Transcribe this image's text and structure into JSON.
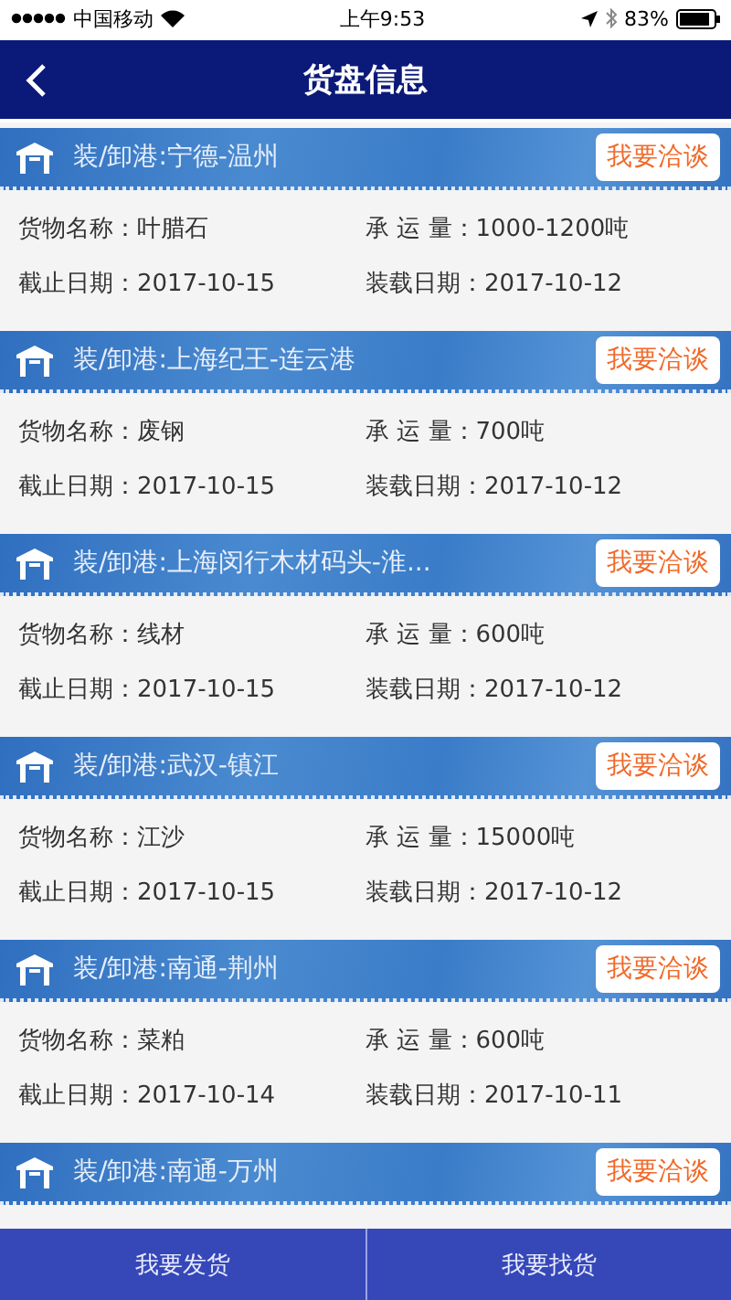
{
  "status_bar": {
    "carrier": "中国移动",
    "time": "上午9:53",
    "battery": "83%"
  },
  "nav": {
    "title": "货盘信息"
  },
  "cargo_list": [
    {
      "route": "装/卸港:宁德-温州",
      "action": "我要洽谈",
      "fields": [
        {
          "label": "货物名称：",
          "value": "叶腊石"
        },
        {
          "label": "承 运 量：",
          "value": "1000-1200吨"
        },
        {
          "label": "截止日期：",
          "value": "2017-10-15"
        },
        {
          "label": "装载日期：",
          "value": "2017-10-12"
        }
      ]
    },
    {
      "route": "装/卸港:上海纪王-连云港",
      "action": "我要洽谈",
      "fields": [
        {
          "label": "货物名称：",
          "value": "废钢"
        },
        {
          "label": "承 运 量：",
          "value": "700吨"
        },
        {
          "label": "截止日期：",
          "value": "2017-10-15"
        },
        {
          "label": "装载日期：",
          "value": "2017-10-12"
        }
      ]
    },
    {
      "route": "装/卸港:上海闵行木材码头-淮...",
      "action": "我要洽谈",
      "fields": [
        {
          "label": "货物名称：",
          "value": "线材"
        },
        {
          "label": "承 运 量：",
          "value": "600吨"
        },
        {
          "label": "截止日期：",
          "value": "2017-10-15"
        },
        {
          "label": "装载日期：",
          "value": "2017-10-12"
        }
      ]
    },
    {
      "route": "装/卸港:武汉-镇江",
      "action": "我要洽谈",
      "fields": [
        {
          "label": "货物名称：",
          "value": "江沙"
        },
        {
          "label": "承 运 量：",
          "value": "15000吨"
        },
        {
          "label": "截止日期：",
          "value": "2017-10-15"
        },
        {
          "label": "装载日期：",
          "value": "2017-10-12"
        }
      ]
    },
    {
      "route": "装/卸港:南通-荆州",
      "action": "我要洽谈",
      "fields": [
        {
          "label": "货物名称：",
          "value": "菜粕"
        },
        {
          "label": "承 运 量：",
          "value": "600吨"
        },
        {
          "label": "截止日期：",
          "value": "2017-10-14"
        },
        {
          "label": "装载日期：",
          "value": "2017-10-11"
        }
      ]
    },
    {
      "route": "装/卸港:南通-万州",
      "action": "我要洽谈"
    }
  ],
  "bottom_bar": [
    "我要发货",
    "我要找货"
  ]
}
